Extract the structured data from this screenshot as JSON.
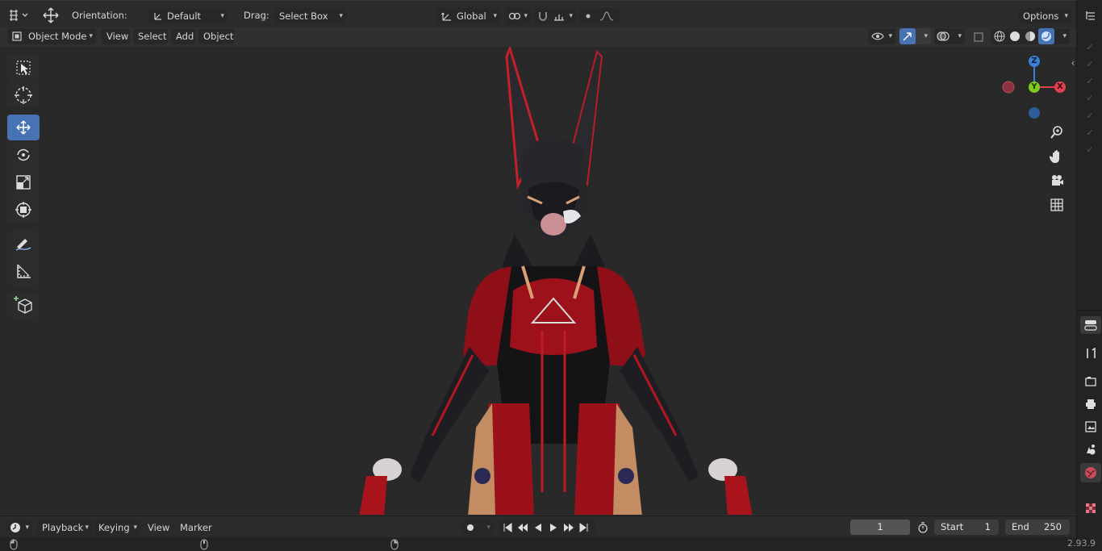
{
  "header": {
    "orientation_label": "Orientation:",
    "orientation_value": "Default",
    "drag_label": "Drag:",
    "drag_value": "Select Box",
    "transform_space": "Global",
    "options_label": "Options"
  },
  "viewport_header": {
    "mode": "Object Mode",
    "menus": [
      "View",
      "Select",
      "Add",
      "Object"
    ]
  },
  "toolbar": {
    "tools": [
      "select-box",
      "cursor",
      "move",
      "rotate",
      "scale",
      "transform",
      "annotate",
      "measure",
      "add-cube"
    ],
    "active_tool": "move"
  },
  "gizmo": {
    "z": "Z",
    "y": "Y",
    "x": "X"
  },
  "timeline": {
    "menus": [
      "Playback",
      "Keying",
      "View",
      "Marker"
    ],
    "current_frame": "1",
    "start_label": "Start",
    "start_value": "1",
    "end_label": "End",
    "end_value": "250"
  },
  "status": {
    "version": "2.93.9"
  },
  "colors": {
    "accent": "#4772b3",
    "x_axis": "#e0404f",
    "y_axis": "#7fc81e",
    "z_axis": "#3a7fd8"
  }
}
